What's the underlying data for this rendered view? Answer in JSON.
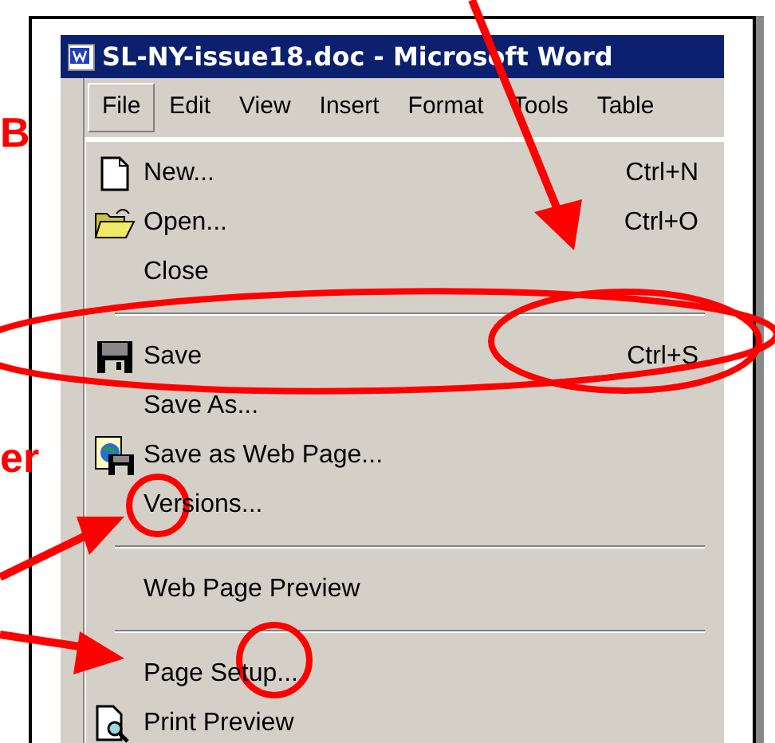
{
  "window": {
    "title": "SL-NY-issue18.doc - Microsoft Word"
  },
  "menu_bar": [
    {
      "label": "File",
      "selected": true
    },
    {
      "label": "Edit",
      "selected": false
    },
    {
      "label": "View",
      "selected": false
    },
    {
      "label": "Insert",
      "selected": false
    },
    {
      "label": "Format",
      "selected": false
    },
    {
      "label": "Tools",
      "selected": false
    },
    {
      "label": "Table",
      "selected": false
    }
  ],
  "file_menu": [
    {
      "kind": "new",
      "label": "New...",
      "shortcut": "Ctrl+N"
    },
    {
      "kind": "open",
      "label": "Open...",
      "shortcut": "Ctrl+O"
    },
    {
      "kind": "plain",
      "label": "Close"
    },
    {
      "kind": "separator"
    },
    {
      "kind": "save",
      "label": "Save",
      "shortcut": "Ctrl+S"
    },
    {
      "kind": "plain",
      "label": "Save As..."
    },
    {
      "kind": "websave",
      "label": "Save as Web Page..."
    },
    {
      "kind": "plain",
      "label": "Versions..."
    },
    {
      "kind": "separator"
    },
    {
      "kind": "plain",
      "label": "Web Page Preview"
    },
    {
      "kind": "separator"
    },
    {
      "kind": "plain",
      "label": "Page Setup..."
    },
    {
      "kind": "preview",
      "label": "Print Preview"
    }
  ],
  "annotations": [
    {
      "text": "B"
    },
    {
      "text": "er"
    }
  ]
}
